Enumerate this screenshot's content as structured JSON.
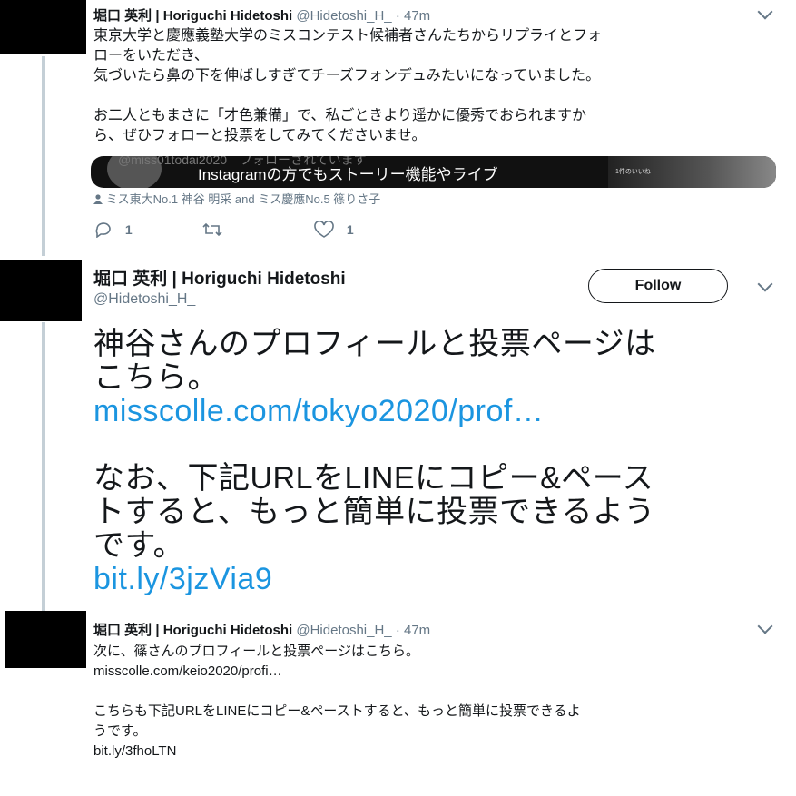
{
  "tweet1": {
    "name": "堀口 英利 | Horiguchi Hidetoshi",
    "handle": "@Hidetoshi_H_",
    "time": "· 47m",
    "lines": [
      "東京大学と慶應義塾大学のミスコンテスト候補者さんたちからリプライとフォ",
      "ローをいただき、",
      "気づいたら鼻の下を伸ばしすぎてチーズフォンデュみたいになっていました。",
      "お二人ともまさに「才色兼備」で、私ごときより遥かに優秀でおられますか",
      "ら、ぜひフォローと投票をしてみてくださいませ。"
    ],
    "card_overlay_top": "@miss01todai2020　フォローされています",
    "card_overlay": "Instagramの方でもストーリー機能やライブ",
    "card_thumb_text": "1件のいいね",
    "attribution": "ミス東大No.1 神谷 明采 and ミス慶應No.5 篠りさ子",
    "reply_count": "1",
    "like_count": "1"
  },
  "tweet2": {
    "name": "堀口 英利 | Horiguchi Hidetoshi",
    "handle": "@Hidetoshi_H_",
    "follow_label": "Follow",
    "line1": "神谷さんのプロフィールと投票ページは",
    "line2": "こちら。",
    "link1": "misscolle.com/tokyo2020/prof…",
    "line3": "なお、下記URLをLINEにコピー&ペース",
    "line4": "トすると、もっと簡単に投票できるよう",
    "line5": "です。",
    "link2": "bit.ly/3jzVia9"
  },
  "tweet3": {
    "name": "堀口 英利 | Horiguchi Hidetoshi",
    "handle": "@Hidetoshi_H_",
    "time": "· 47m",
    "line1": "次に、篠さんのプロフィールと投票ページはこちら。",
    "link1": "misscolle.com/keio2020/profi…",
    "line2": "こちらも下記URLをLINEにコピー&ペーストすると、もっと簡単に投票できるよ",
    "line3": "うです。",
    "link2": "bit.ly/3fhoLTN"
  },
  "colors": {
    "link": "#1b95e0",
    "muted": "#657786",
    "thread": "#c4cfd6"
  },
  "icons": [
    "reply-icon",
    "retweet-icon",
    "like-icon",
    "person-icon",
    "chevron-down-icon"
  ]
}
